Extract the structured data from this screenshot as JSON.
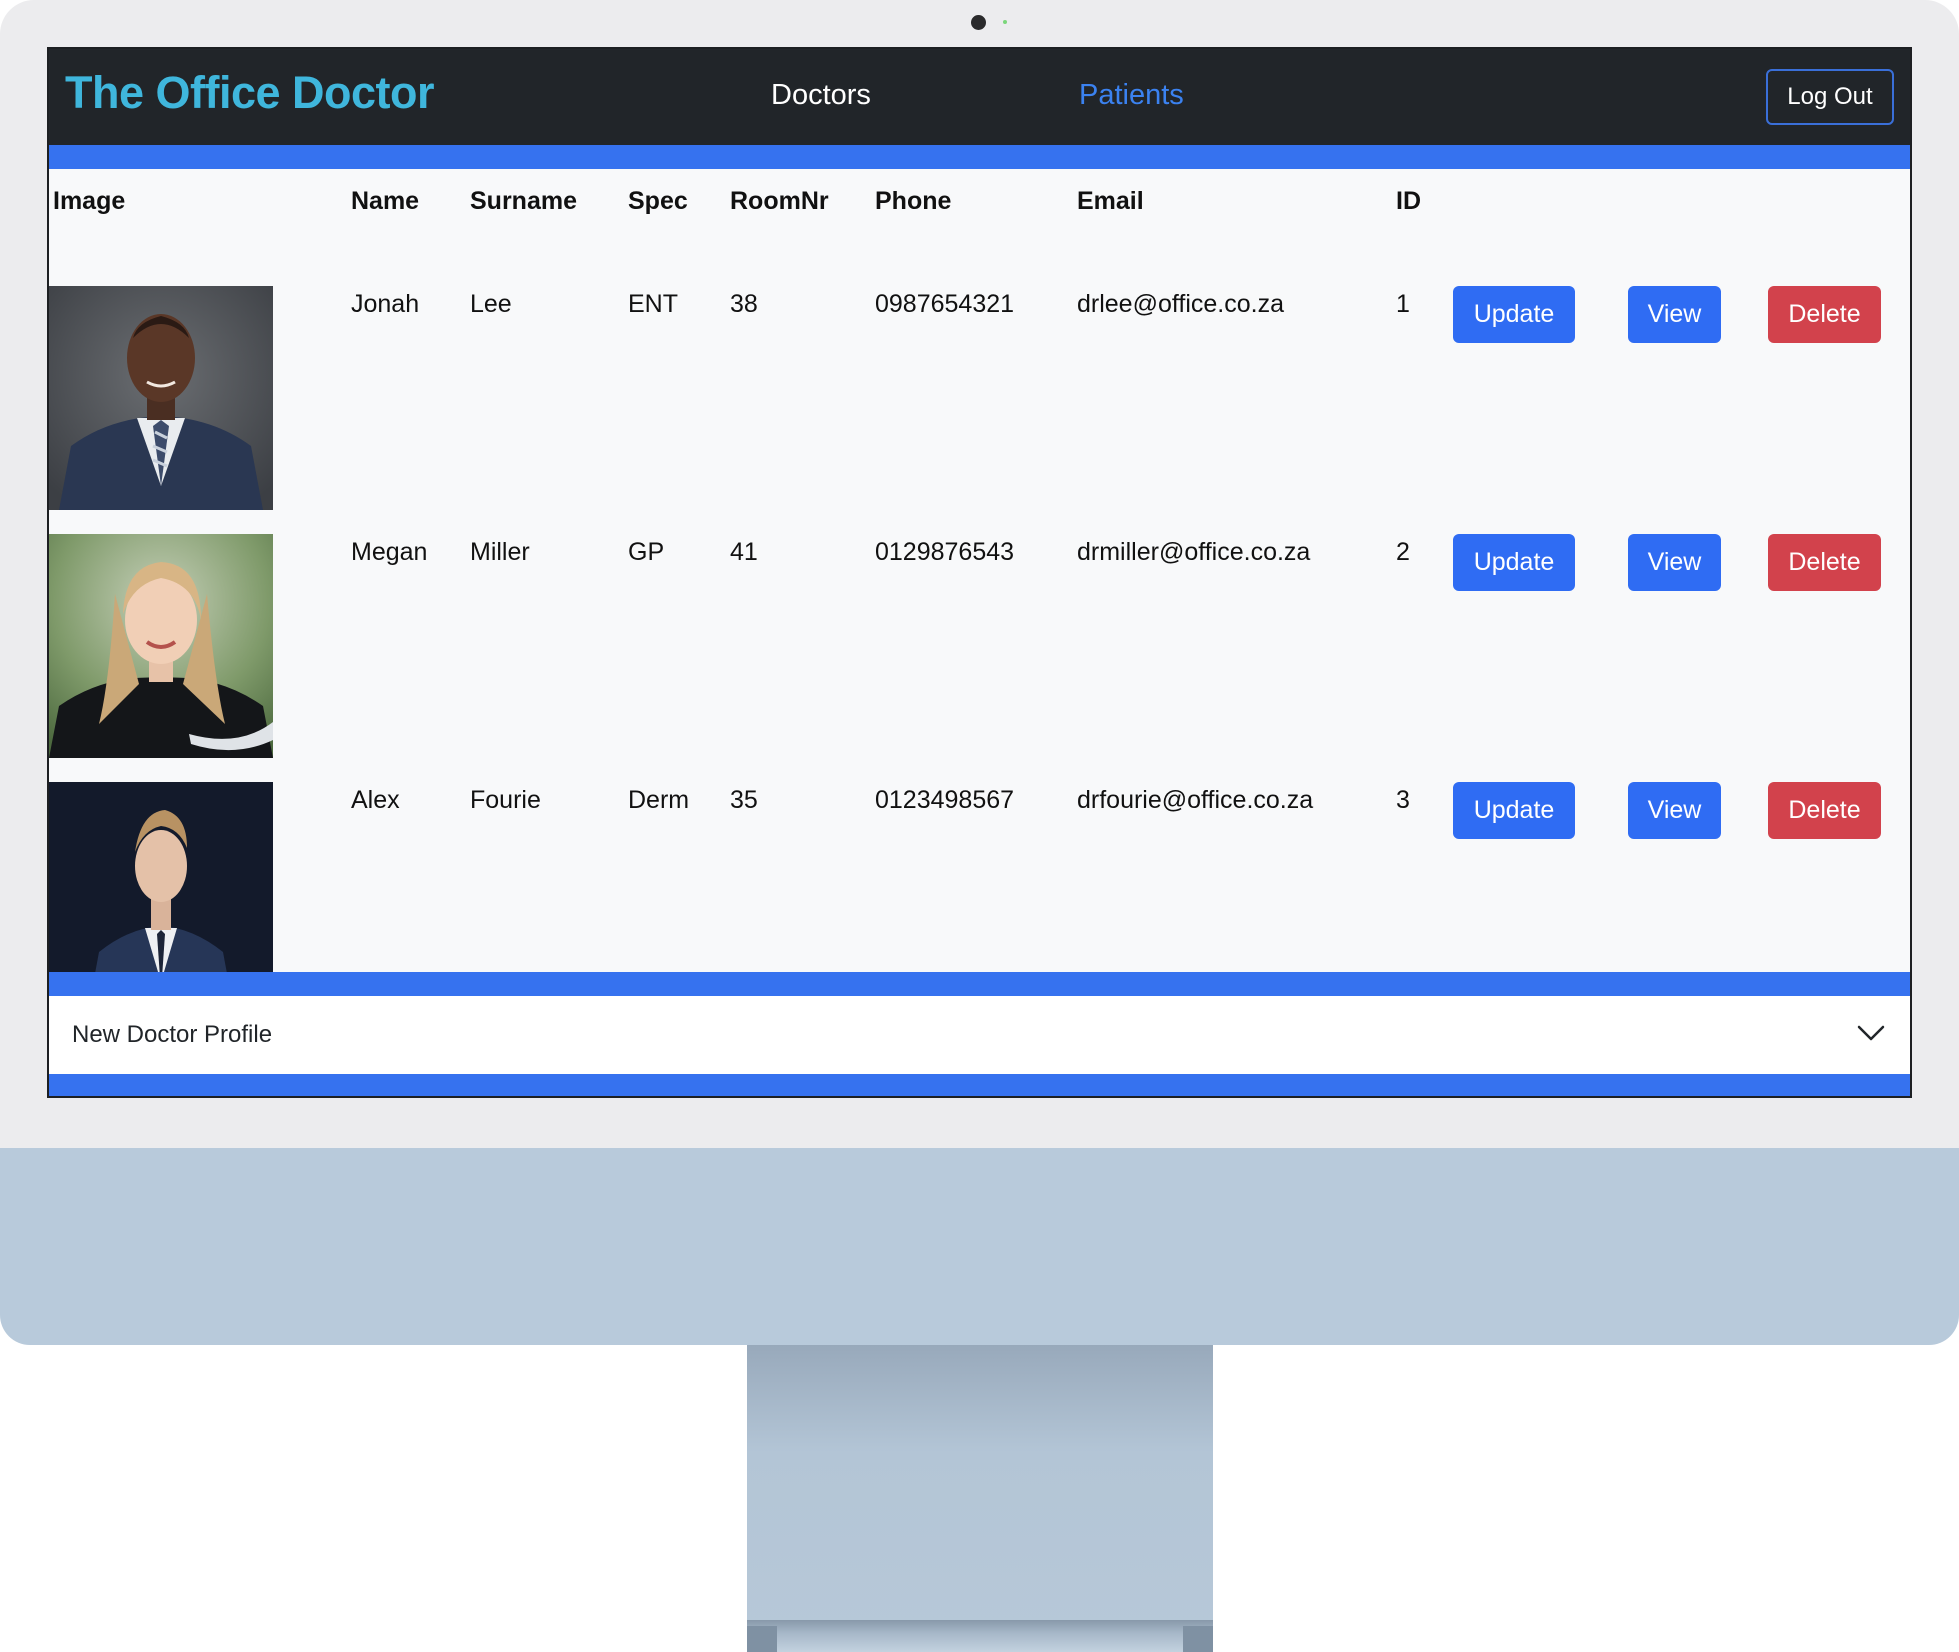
{
  "navbar": {
    "brand": "The Office Doctor",
    "links": [
      {
        "label": "Doctors"
      },
      {
        "label": "Patients"
      }
    ],
    "logout_label": "Log Out"
  },
  "table": {
    "headers": [
      "Image",
      "Name",
      "Surname",
      "Spec",
      "RoomNr",
      "Phone",
      "Email",
      "ID"
    ],
    "rows": [
      {
        "image": "doctor-portrait-1",
        "name": "Jonah",
        "surname": "Lee",
        "spec": "ENT",
        "room": "38",
        "phone": "0987654321",
        "email": "drlee@office.co.za",
        "id": "1"
      },
      {
        "image": "doctor-portrait-2",
        "name": "Megan",
        "surname": "Miller",
        "spec": "GP",
        "room": "41",
        "phone": "0129876543",
        "email": "drmiller@office.co.za",
        "id": "2"
      },
      {
        "image": "doctor-portrait-3",
        "name": "Alex",
        "surname": "Fourie",
        "spec": "Derm",
        "room": "35",
        "phone": "0123498567",
        "email": "drfourie@office.co.za",
        "id": "3"
      }
    ],
    "actions": {
      "update": "Update",
      "view": "View",
      "delete": "Delete"
    }
  },
  "accordion": {
    "label": "New Doctor Profile",
    "icon": "chevron-down-icon"
  },
  "colors": {
    "navbar_bg": "#212529",
    "brand": "#3fb6dc",
    "accent_blue": "#3672ef",
    "primary_button": "#2f6cf3",
    "danger_button": "#d2424c",
    "active_link": "#3b82f0"
  }
}
